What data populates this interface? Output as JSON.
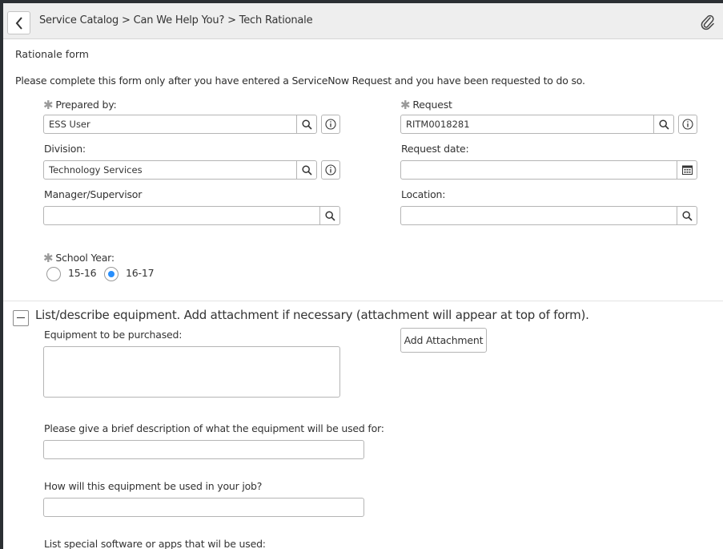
{
  "header": {
    "breadcrumb": "Service Catalog > Can We Help You? > Tech Rationale"
  },
  "form": {
    "title": "Rationale form",
    "intro": "Please complete this form only after you have entered a ServiceNow Request and you have been requested to do so.",
    "prepared_by": {
      "label": "Prepared by:",
      "value": "ESS User",
      "required": true
    },
    "request": {
      "label": "Request",
      "value": "RITM0018281",
      "required": true
    },
    "division": {
      "label": "Division:",
      "value": "Technology Services"
    },
    "request_date": {
      "label": "Request date:",
      "value": ""
    },
    "manager": {
      "label": "Manager/Supervisor",
      "value": ""
    },
    "location": {
      "label": "Location:",
      "value": ""
    },
    "school_year": {
      "label": "School Year:",
      "required": true,
      "options": [
        "15-16",
        "16-17"
      ],
      "selected": "16-17"
    }
  },
  "section": {
    "title": "List/describe equipment. Add attachment if necessary (attachment will appear at top of form).",
    "equipment_label": "Equipment to be purchased:",
    "add_attachment_label": "Add Attachment",
    "description_label": "Please give a brief description of what the equipment will be used for:",
    "job_use_label": "How will this equipment be used in your job?",
    "software_label": "List special software or apps that wil be used:"
  },
  "colors": {
    "accent": "#278efc",
    "header_bg": "#eeeeee",
    "border": "#b5b5b5"
  }
}
